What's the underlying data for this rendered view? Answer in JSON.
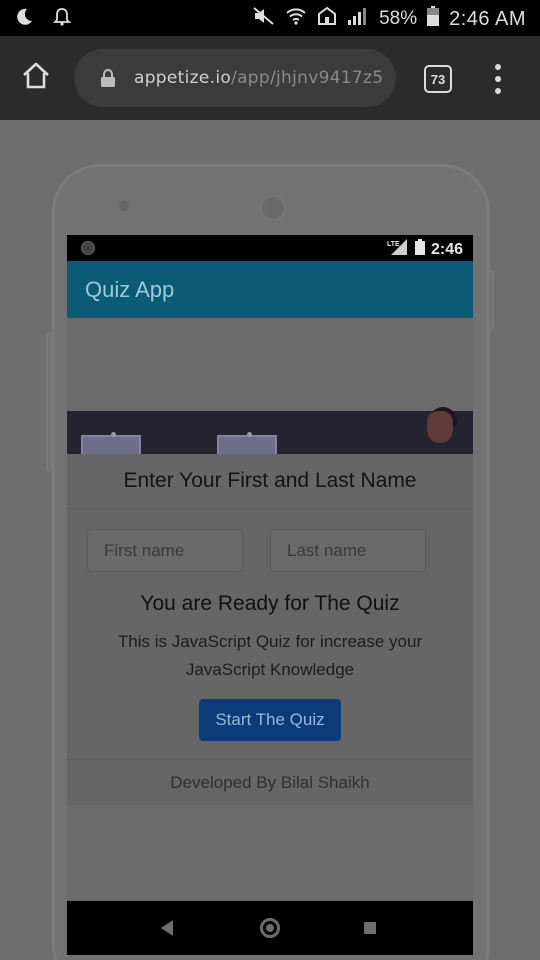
{
  "status_bar": {
    "battery": "58%",
    "time": "2:46 AM",
    "icons": [
      "moon-icon",
      "bell-icon",
      "mute-icon",
      "wifi-icon",
      "home-network-icon",
      "signal-icon",
      "battery-icon"
    ]
  },
  "browser": {
    "url_host": "appetize.io",
    "url_path": "/app/jhjnv9417z5",
    "tab_count": "73"
  },
  "device_screen": {
    "status_time": "2:46",
    "status_network": "LTE",
    "app_title": "Quiz App",
    "modal": {
      "header": "Enter Your First and Last Name",
      "first_name_placeholder": "First name",
      "last_name_placeholder": "Last name",
      "ready_title": "You are Ready for The Quiz",
      "description": "This is JavaScript Quiz for increase your JavaScript Knowledge",
      "start_button": "Start The Quiz",
      "footer": "Developed By Bilal Shaikh"
    }
  },
  "colors": {
    "app_bar": "#0b5b77",
    "start_button": "#0b3b78",
    "toolbar": "#2b2b2b"
  }
}
